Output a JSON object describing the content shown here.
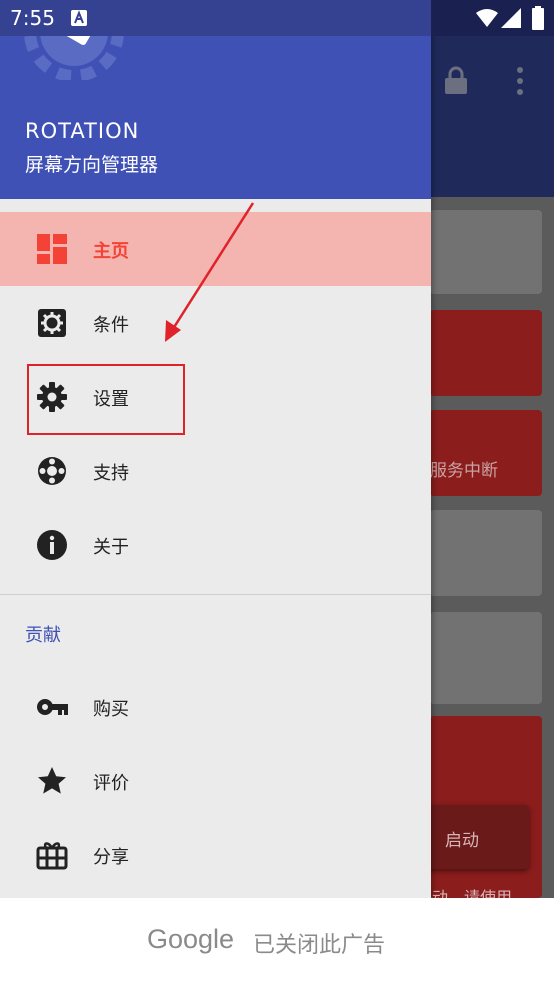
{
  "status_bar": {
    "time": "7:55"
  },
  "drawer": {
    "app_name": "ROTATION",
    "app_subtitle": "屏幕方向管理器",
    "items": [
      {
        "label": "主页",
        "icon": "dashboard-icon",
        "selected": true
      },
      {
        "label": "条件",
        "icon": "gear-box-icon"
      },
      {
        "label": "设置",
        "icon": "gear-icon"
      },
      {
        "label": "支持",
        "icon": "lifebuoy-icon"
      },
      {
        "label": "关于",
        "icon": "info-icon"
      }
    ],
    "section_title": "贡献",
    "section_items": [
      {
        "label": "购买",
        "icon": "key-icon"
      },
      {
        "label": "评价",
        "icon": "star-icon"
      },
      {
        "label": "分享",
        "icon": "gift-icon"
      }
    ]
  },
  "background_app": {
    "card_text": "服务中断",
    "fab_label": "启动",
    "bottom_text": "动，请使用"
  },
  "ad_banner": {
    "brand": "Google",
    "message": "已关闭此广告"
  },
  "colors": {
    "primary": "#3f51b5",
    "accent": "#f44336",
    "selected_bg": "#f4b5b1",
    "annotation": "#e0222a"
  }
}
